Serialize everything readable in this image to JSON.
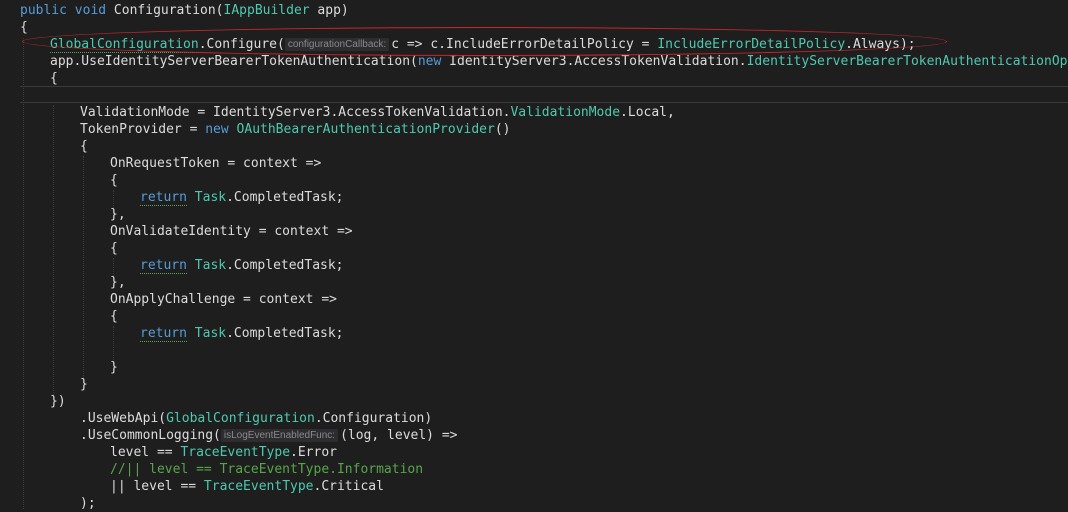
{
  "editor": {
    "lines": {
      "l0": {
        "kw1": "public",
        "kw2": "void",
        "rest": " Configuration(",
        "type": "IAppBuilder",
        "rest2": " app)"
      },
      "l1": {
        "text": "{"
      },
      "l2": {
        "type": "GlobalConfiguration",
        "rest": ".Configure(",
        "hint": "configurationCallback:",
        "rest2": "c => c.IncludeErrorDetailPolicy = ",
        "type2": "IncludeErrorDetailPolicy",
        "rest3": ".Always);"
      },
      "l3": {
        "text": "app.UseIdentityServerBearerTokenAuthentication(",
        "kw": "new",
        "ns": " IdentityServer3.AccessTokenValidation.",
        "type": "IdentityServerBearerTokenAuthenticationOptions",
        "tail": "("
      },
      "l4": {
        "text": "{"
      },
      "l5": {
        "text": "ValidationMode = IdentityServer3.AccessTokenValidation.",
        "type": "ValidationMode",
        "rest": ".Local,"
      },
      "l6": {
        "text": "TokenProvider = ",
        "kw": "new",
        "type": " OAuthBearerAuthenticationProvider",
        "rest": "()"
      },
      "l7": {
        "text": "{"
      },
      "l8": {
        "text": "OnRequestToken = context =>"
      },
      "l9": {
        "text": "{"
      },
      "l10": {
        "kw": "return",
        "type": "Task",
        "rest": ".CompletedTask;"
      },
      "l11": {
        "text": "},"
      },
      "l12": {
        "text": "OnValidateIdentity = context =>"
      },
      "l13": {
        "text": "{"
      },
      "l14": {
        "kw": "return",
        "type": "Task",
        "rest": ".CompletedTask;"
      },
      "l15": {
        "text": "},"
      },
      "l16": {
        "text": "OnApplyChallenge = context =>"
      },
      "l17": {
        "text": "{"
      },
      "l18": {
        "kw": "return",
        "type": "Task",
        "rest": ".CompletedTask;"
      },
      "l19": {
        "text": "}"
      },
      "l20": {
        "text": "}"
      },
      "l21": {
        "text": "})"
      },
      "l22": {
        "text": ".UseWebApi(",
        "type": "GlobalConfiguration",
        "rest": ".Configuration)"
      },
      "l23": {
        "text": ".UseCommonLogging(",
        "hint": "isLogEventEnabledFunc:",
        "rest": "(log, level) =>"
      },
      "l24": {
        "text": "level == ",
        "type": "TraceEventType",
        "rest": ".Error"
      },
      "l25": {
        "comment": "//|| level == TraceEventType.Information"
      },
      "l26": {
        "text": "|| level == ",
        "type": "TraceEventType",
        "rest": ".Critical"
      },
      "l27": {
        "text": ");"
      }
    }
  },
  "colors": {
    "background": "#1e1e1e",
    "keyword": "#569cd6",
    "type": "#4ec9b0",
    "comment": "#57a64a",
    "highlight": "#c8282b"
  }
}
